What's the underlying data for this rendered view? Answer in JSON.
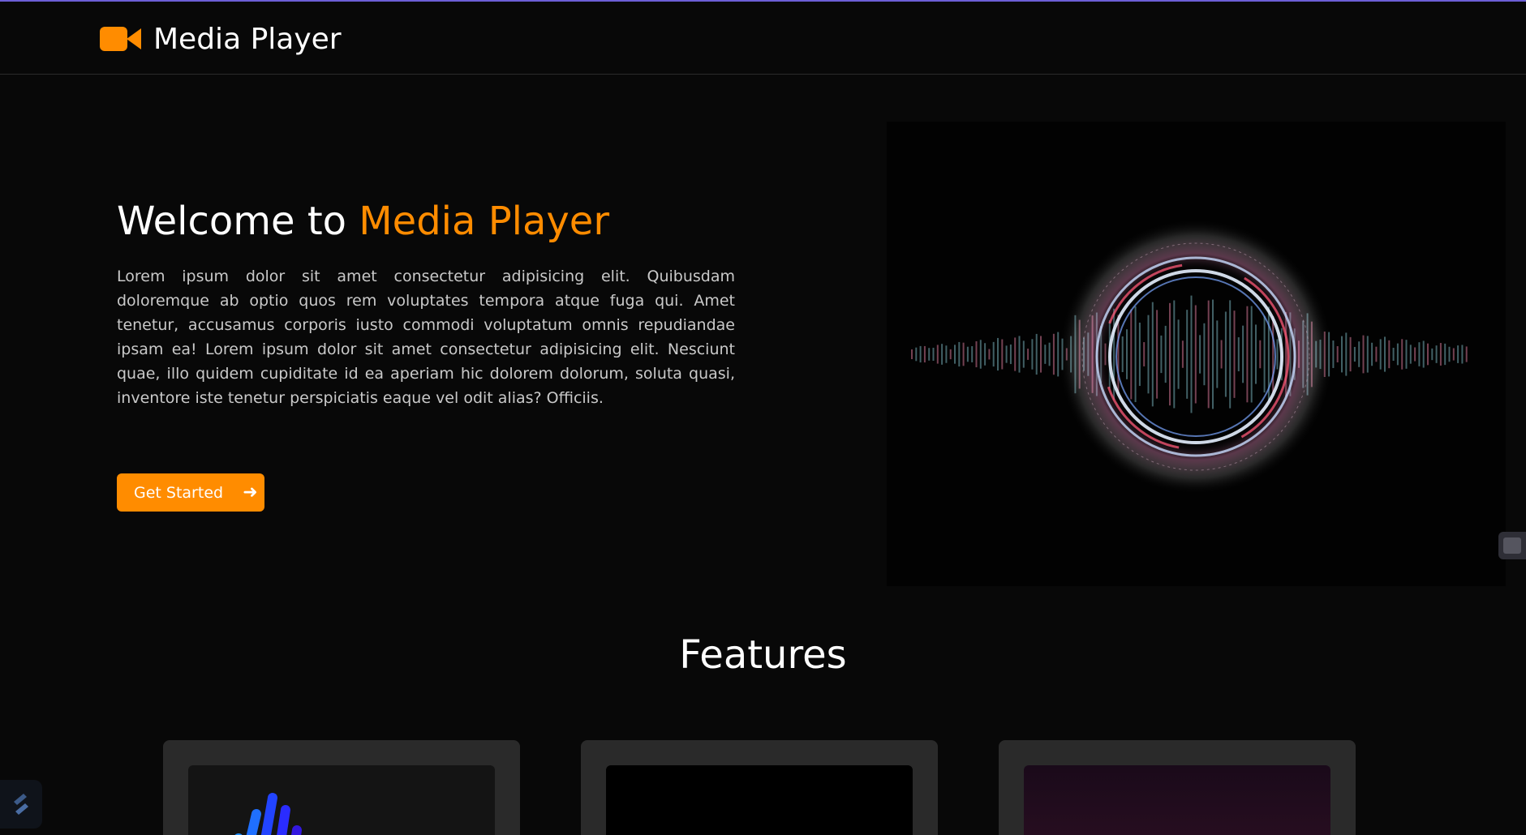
{
  "app": {
    "name": "Media Player",
    "accent_color": "#ff8c00",
    "logo_icon": "video-camera-icon"
  },
  "hero": {
    "title_prefix": "Welcome to ",
    "title_accent": "Media Player",
    "paragraph": "Lorem ipsum dolor sit amet consectetur adipisicing elit. Quibusdam doloremque ab optio quos rem voluptates tempora atque fuga qui. Amet tenetur, accusamus corporis iusto commodi voluptatum omnis repudiandae ipsam ea! Lorem ipsum dolor sit amet consectetur adipisicing elit. Nesciunt quae, illo quidem cupiditate id ea aperiam hic dolorem dolorum, soluta quasi, inventore iste tenetur perspiciatis eaque vel odit alias? Officiis.",
    "cta_label": "Get Started",
    "cta_icon": "arrow-right-icon",
    "image": "circular-audio-waveform-visualizer"
  },
  "features": {
    "title": "Features",
    "cards": [
      {
        "image": "blue-equalizer-bars"
      },
      {
        "image": "black-media-thumbnail"
      },
      {
        "image": "purple-neon-grid"
      }
    ]
  }
}
